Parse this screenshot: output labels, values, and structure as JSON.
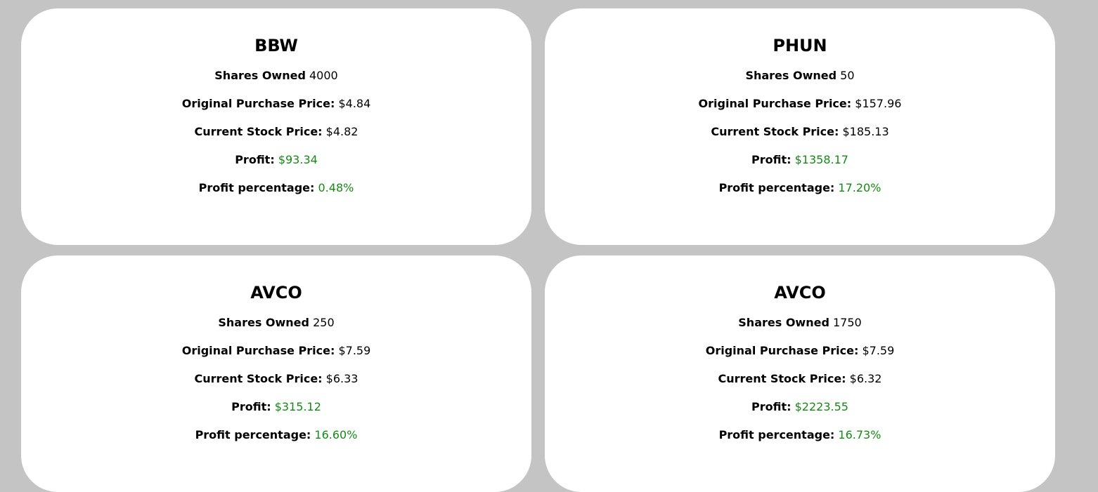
{
  "colors": {
    "background": "#c4c4c4",
    "card": "#ffffff",
    "positive": "#148a14"
  },
  "labels": {
    "shares": "Shares Owned",
    "original": "Original Purchase Price:",
    "current": "Current Stock Price:",
    "profit": "Profit:",
    "profit_pct": "Profit percentage:"
  },
  "stocks": [
    {
      "ticker": "BBW",
      "shares": "4000",
      "original_price": "$4.84",
      "current_price": "$4.82",
      "profit": "$93.34",
      "profit_pct": "0.48%"
    },
    {
      "ticker": "PHUN",
      "shares": "50",
      "original_price": "$157.96",
      "current_price": "$185.13",
      "profit": "$1358.17",
      "profit_pct": "17.20%"
    },
    {
      "ticker": "AVCO",
      "shares": "250",
      "original_price": "$7.59",
      "current_price": "$6.33",
      "profit": "$315.12",
      "profit_pct": "16.60%"
    },
    {
      "ticker": "AVCO",
      "shares": "1750",
      "original_price": "$7.59",
      "current_price": "$6.32",
      "profit": "$2223.55",
      "profit_pct": "16.73%"
    }
  ]
}
